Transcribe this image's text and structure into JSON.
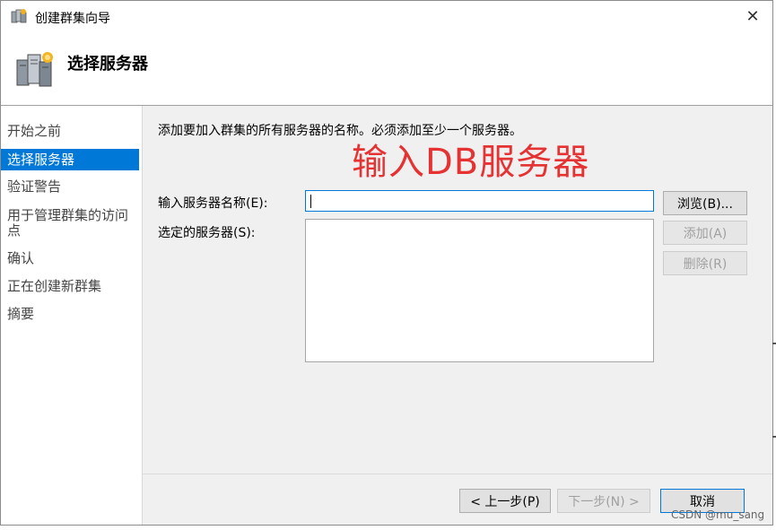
{
  "window": {
    "title": "创建群集向导",
    "close_glyph": "✕"
  },
  "header": {
    "title": "选择服务器"
  },
  "sidebar": {
    "items": [
      {
        "label": "开始之前",
        "active": false
      },
      {
        "label": "选择服务器",
        "active": true
      },
      {
        "label": "验证警告",
        "active": false
      },
      {
        "label": "用于管理群集的访问点",
        "active": false
      },
      {
        "label": "确认",
        "active": false
      },
      {
        "label": "正在创建新群集",
        "active": false
      },
      {
        "label": "摘要",
        "active": false
      }
    ]
  },
  "main": {
    "description": "添加要加入群集的所有服务器的名称。必须添加至少一个服务器。",
    "annotation": "输入DB服务器",
    "server_name_label": "输入服务器名称(E):",
    "server_name_value": "",
    "selected_servers_label": "选定的服务器(S):",
    "selected_servers": [],
    "browse_button": "浏览(B)...",
    "add_button": "添加(A)",
    "remove_button": "删除(R)"
  },
  "footer": {
    "prev_button": "< 上一步(P)",
    "next_button": "下一步(N) >",
    "cancel_button": "取消"
  },
  "watermark": "CSDN @mu_sang",
  "colors": {
    "accent": "#0078d7",
    "annotation": "#e53333"
  }
}
